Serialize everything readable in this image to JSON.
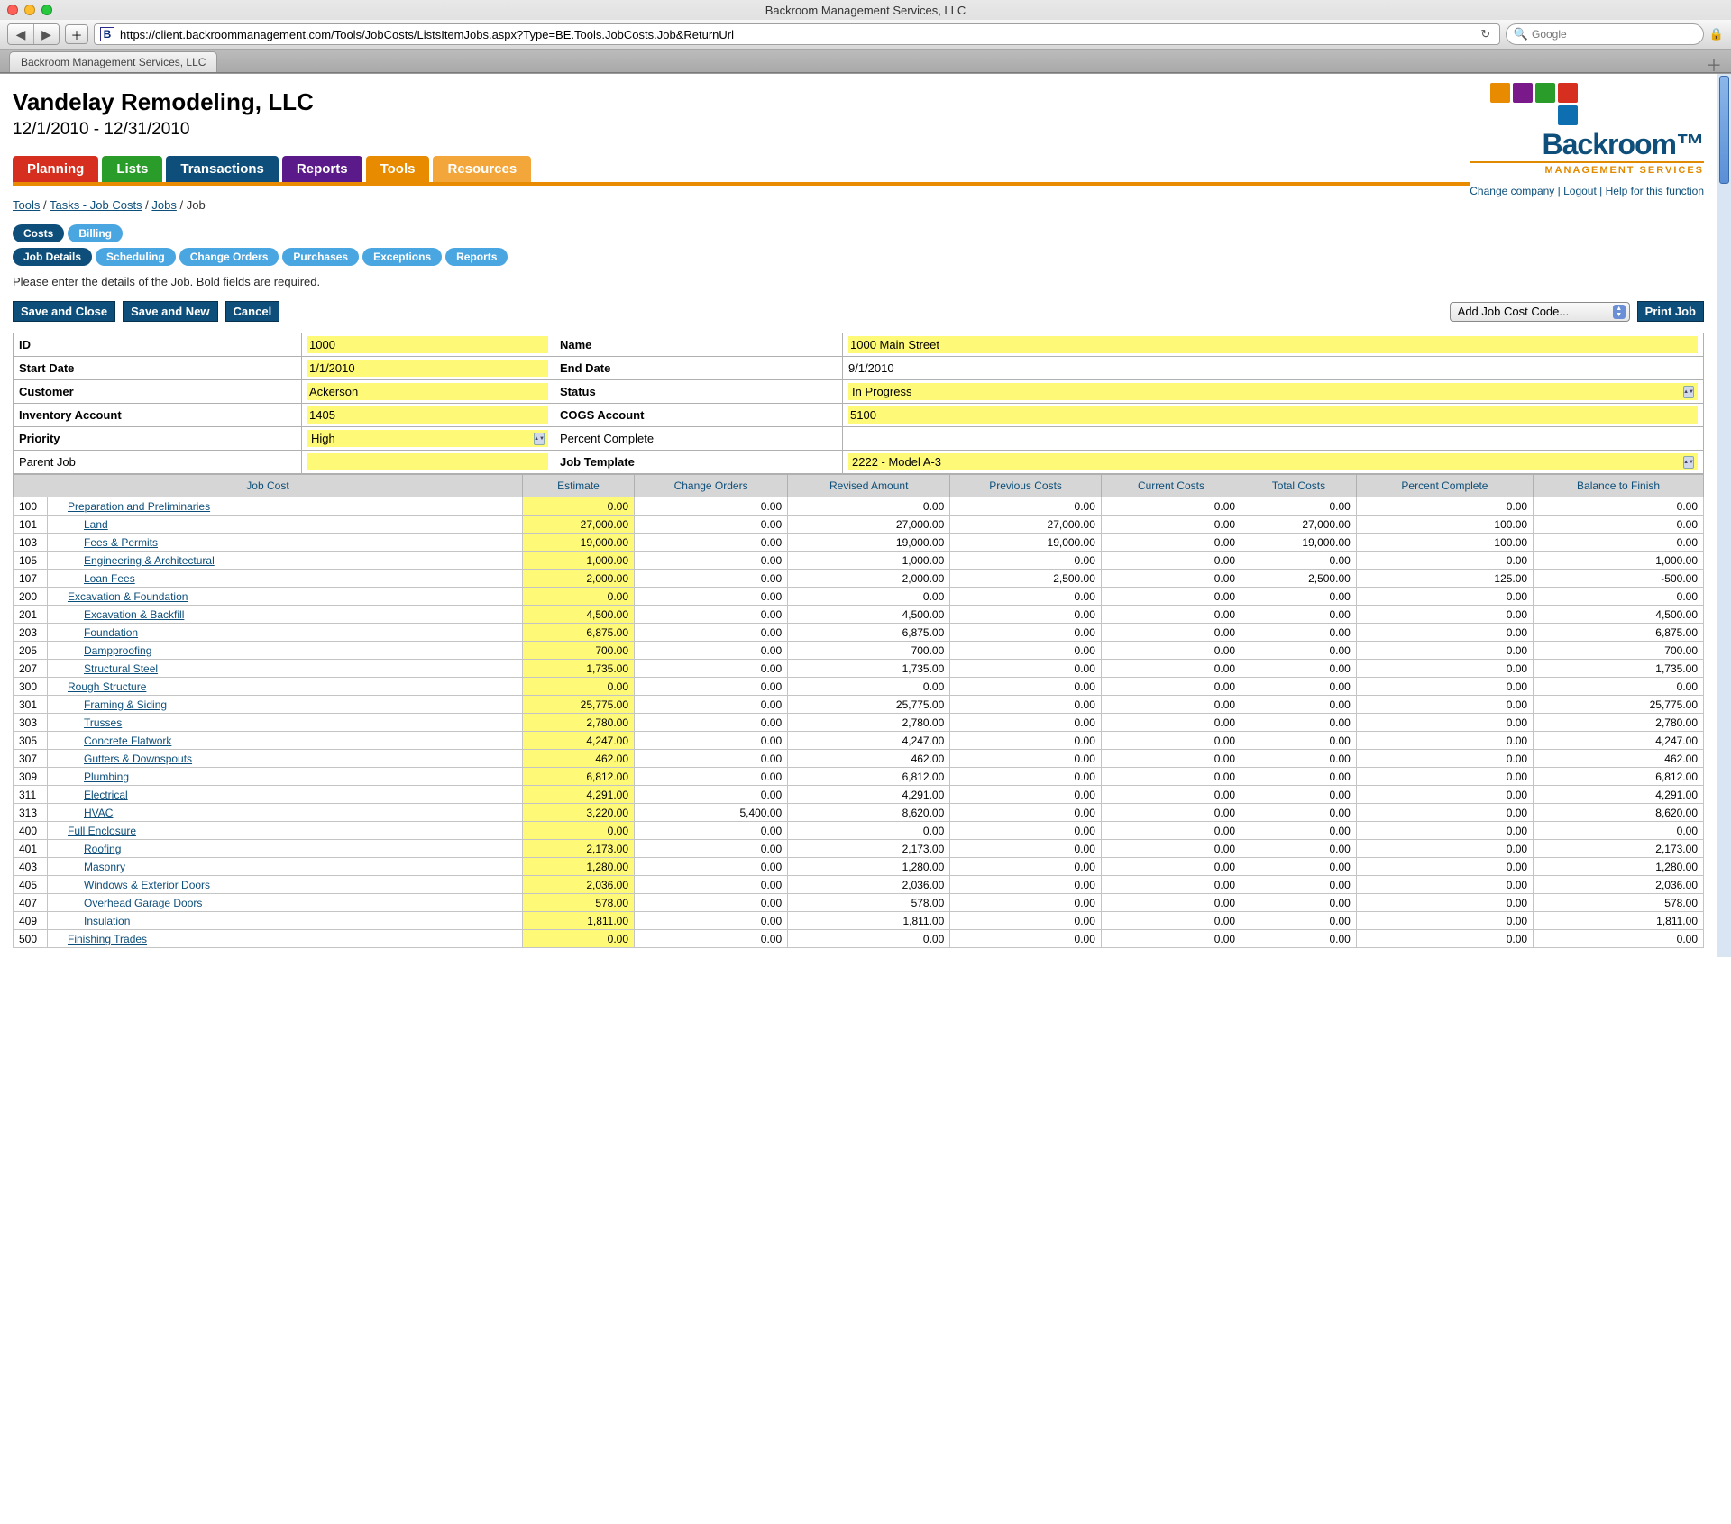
{
  "window": {
    "title": "Backroom Management Services, LLC",
    "url": "https://client.backroommanagement.com/Tools/JobCosts/ListsItemJobs.aspx?Type=BE.Tools.JobCosts.Job&ReturnUrl",
    "search_placeholder": "Google",
    "tab": "Backroom Management Services, LLC"
  },
  "header": {
    "company": "Vandelay Remodeling, LLC",
    "date_range": "12/1/2010 - 12/31/2010",
    "logo_name": "Backroom",
    "logo_sub": "MANAGEMENT SERVICES",
    "links": {
      "change": "Change company",
      "logout": "Logout",
      "help": "Help for this function"
    }
  },
  "mainnav": {
    "planning": "Planning",
    "lists": "Lists",
    "transactions": "Transactions",
    "reports": "Reports",
    "tools": "Tools",
    "resources": "Resources"
  },
  "breadcrumb": {
    "tools": "Tools",
    "tasks": "Tasks - Job Costs",
    "jobs": "Jobs",
    "job": "Job"
  },
  "tabs1": {
    "costs": "Costs",
    "billing": "Billing"
  },
  "tabs2": {
    "details": "Job Details",
    "scheduling": "Scheduling",
    "changeorders": "Change Orders",
    "purchases": "Purchases",
    "exceptions": "Exceptions",
    "reports": "Reports"
  },
  "instructions": "Please enter the details of the Job. Bold fields are required.",
  "buttons": {
    "save_close": "Save and Close",
    "save_new": "Save and New",
    "cancel": "Cancel",
    "add_code": "Add Job Cost Code...",
    "print": "Print Job"
  },
  "form": {
    "id_label": "ID",
    "id": "1000",
    "name_label": "Name",
    "name": "1000 Main Street",
    "start_label": "Start Date",
    "start": "1/1/2010",
    "end_label": "End Date",
    "end": "9/1/2010",
    "customer_label": "Customer",
    "customer": "Ackerson",
    "status_label": "Status",
    "status": "In Progress",
    "inventory_label": "Inventory Account",
    "inventory": "1405",
    "cogs_label": "COGS Account",
    "cogs": "5100",
    "priority_label": "Priority",
    "priority": "High",
    "percent_label": "Percent Complete",
    "percent": "",
    "parent_label": "Parent Job",
    "parent": "",
    "template_label": "Job Template",
    "template": "2222 - Model A-3"
  },
  "grid": {
    "headers": {
      "jobcost": "Job Cost",
      "estimate": "Estimate",
      "change": "Change Orders",
      "revised": "Revised Amount",
      "previous": "Previous Costs",
      "current": "Current Costs",
      "total": "Total Costs",
      "pct": "Percent Complete",
      "balance": "Balance to Finish"
    },
    "rows": [
      {
        "code": "100",
        "desc": "Preparation and Preliminaries",
        "indent": 1,
        "section": true,
        "est": "0.00",
        "chg": "0.00",
        "rev": "0.00",
        "prev": "0.00",
        "cur": "0.00",
        "tot": "0.00",
        "pct": "0.00",
        "bal": "0.00"
      },
      {
        "code": "101",
        "desc": "Land",
        "indent": 2,
        "est": "27,000.00",
        "chg": "0.00",
        "rev": "27,000.00",
        "prev": "27,000.00",
        "cur": "0.00",
        "tot": "27,000.00",
        "pct": "100.00",
        "bal": "0.00"
      },
      {
        "code": "103",
        "desc": "Fees & Permits",
        "indent": 2,
        "est": "19,000.00",
        "chg": "0.00",
        "rev": "19,000.00",
        "prev": "19,000.00",
        "cur": "0.00",
        "tot": "19,000.00",
        "pct": "100.00",
        "bal": "0.00"
      },
      {
        "code": "105",
        "desc": "Engineering & Architectural",
        "indent": 2,
        "est": "1,000.00",
        "chg": "0.00",
        "rev": "1,000.00",
        "prev": "0.00",
        "cur": "0.00",
        "tot": "0.00",
        "pct": "0.00",
        "bal": "1,000.00"
      },
      {
        "code": "107",
        "desc": "Loan Fees",
        "indent": 2,
        "est": "2,000.00",
        "chg": "0.00",
        "rev": "2,000.00",
        "prev": "2,500.00",
        "cur": "0.00",
        "tot": "2,500.00",
        "pct": "125.00",
        "bal": "-500.00"
      },
      {
        "code": "200",
        "desc": "Excavation & Foundation",
        "indent": 1,
        "section": true,
        "est": "0.00",
        "chg": "0.00",
        "rev": "0.00",
        "prev": "0.00",
        "cur": "0.00",
        "tot": "0.00",
        "pct": "0.00",
        "bal": "0.00"
      },
      {
        "code": "201",
        "desc": "Excavation & Backfill",
        "indent": 2,
        "est": "4,500.00",
        "chg": "0.00",
        "rev": "4,500.00",
        "prev": "0.00",
        "cur": "0.00",
        "tot": "0.00",
        "pct": "0.00",
        "bal": "4,500.00"
      },
      {
        "code": "203",
        "desc": "Foundation",
        "indent": 2,
        "est": "6,875.00",
        "chg": "0.00",
        "rev": "6,875.00",
        "prev": "0.00",
        "cur": "0.00",
        "tot": "0.00",
        "pct": "0.00",
        "bal": "6,875.00"
      },
      {
        "code": "205",
        "desc": "Dampproofing",
        "indent": 2,
        "est": "700.00",
        "chg": "0.00",
        "rev": "700.00",
        "prev": "0.00",
        "cur": "0.00",
        "tot": "0.00",
        "pct": "0.00",
        "bal": "700.00"
      },
      {
        "code": "207",
        "desc": "Structural Steel",
        "indent": 2,
        "est": "1,735.00",
        "chg": "0.00",
        "rev": "1,735.00",
        "prev": "0.00",
        "cur": "0.00",
        "tot": "0.00",
        "pct": "0.00",
        "bal": "1,735.00"
      },
      {
        "code": "300",
        "desc": "Rough Structure",
        "indent": 1,
        "section": true,
        "est": "0.00",
        "chg": "0.00",
        "rev": "0.00",
        "prev": "0.00",
        "cur": "0.00",
        "tot": "0.00",
        "pct": "0.00",
        "bal": "0.00"
      },
      {
        "code": "301",
        "desc": "Framing & Siding",
        "indent": 2,
        "est": "25,775.00",
        "chg": "0.00",
        "rev": "25,775.00",
        "prev": "0.00",
        "cur": "0.00",
        "tot": "0.00",
        "pct": "0.00",
        "bal": "25,775.00"
      },
      {
        "code": "303",
        "desc": "Trusses",
        "indent": 2,
        "est": "2,780.00",
        "chg": "0.00",
        "rev": "2,780.00",
        "prev": "0.00",
        "cur": "0.00",
        "tot": "0.00",
        "pct": "0.00",
        "bal": "2,780.00"
      },
      {
        "code": "305",
        "desc": "Concrete Flatwork",
        "indent": 2,
        "est": "4,247.00",
        "chg": "0.00",
        "rev": "4,247.00",
        "prev": "0.00",
        "cur": "0.00",
        "tot": "0.00",
        "pct": "0.00",
        "bal": "4,247.00"
      },
      {
        "code": "307",
        "desc": "Gutters & Downspouts",
        "indent": 2,
        "est": "462.00",
        "chg": "0.00",
        "rev": "462.00",
        "prev": "0.00",
        "cur": "0.00",
        "tot": "0.00",
        "pct": "0.00",
        "bal": "462.00"
      },
      {
        "code": "309",
        "desc": "Plumbing",
        "indent": 2,
        "est": "6,812.00",
        "chg": "0.00",
        "rev": "6,812.00",
        "prev": "0.00",
        "cur": "0.00",
        "tot": "0.00",
        "pct": "0.00",
        "bal": "6,812.00"
      },
      {
        "code": "311",
        "desc": "Electrical",
        "indent": 2,
        "est": "4,291.00",
        "chg": "0.00",
        "rev": "4,291.00",
        "prev": "0.00",
        "cur": "0.00",
        "tot": "0.00",
        "pct": "0.00",
        "bal": "4,291.00"
      },
      {
        "code": "313",
        "desc": "HVAC",
        "indent": 2,
        "est": "3,220.00",
        "chg": "5,400.00",
        "rev": "8,620.00",
        "prev": "0.00",
        "cur": "0.00",
        "tot": "0.00",
        "pct": "0.00",
        "bal": "8,620.00"
      },
      {
        "code": "400",
        "desc": "Full Enclosure",
        "indent": 1,
        "section": true,
        "est": "0.00",
        "chg": "0.00",
        "rev": "0.00",
        "prev": "0.00",
        "cur": "0.00",
        "tot": "0.00",
        "pct": "0.00",
        "bal": "0.00"
      },
      {
        "code": "401",
        "desc": "Roofing",
        "indent": 2,
        "est": "2,173.00",
        "chg": "0.00",
        "rev": "2,173.00",
        "prev": "0.00",
        "cur": "0.00",
        "tot": "0.00",
        "pct": "0.00",
        "bal": "2,173.00"
      },
      {
        "code": "403",
        "desc": "Masonry",
        "indent": 2,
        "est": "1,280.00",
        "chg": "0.00",
        "rev": "1,280.00",
        "prev": "0.00",
        "cur": "0.00",
        "tot": "0.00",
        "pct": "0.00",
        "bal": "1,280.00"
      },
      {
        "code": "405",
        "desc": "Windows & Exterior Doors",
        "indent": 2,
        "est": "2,036.00",
        "chg": "0.00",
        "rev": "2,036.00",
        "prev": "0.00",
        "cur": "0.00",
        "tot": "0.00",
        "pct": "0.00",
        "bal": "2,036.00"
      },
      {
        "code": "407",
        "desc": "Overhead Garage Doors",
        "indent": 2,
        "est": "578.00",
        "chg": "0.00",
        "rev": "578.00",
        "prev": "0.00",
        "cur": "0.00",
        "tot": "0.00",
        "pct": "0.00",
        "bal": "578.00"
      },
      {
        "code": "409",
        "desc": "Insulation",
        "indent": 2,
        "est": "1,811.00",
        "chg": "0.00",
        "rev": "1,811.00",
        "prev": "0.00",
        "cur": "0.00",
        "tot": "0.00",
        "pct": "0.00",
        "bal": "1,811.00"
      },
      {
        "code": "500",
        "desc": "Finishing Trades",
        "indent": 1,
        "section": true,
        "est": "0.00",
        "chg": "0.00",
        "rev": "0.00",
        "prev": "0.00",
        "cur": "0.00",
        "tot": "0.00",
        "pct": "0.00",
        "bal": "0.00"
      }
    ]
  }
}
